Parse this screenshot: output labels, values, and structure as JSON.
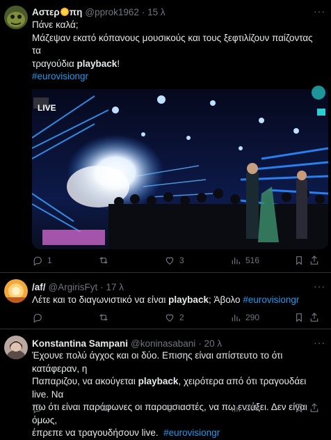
{
  "tweets": [
    {
      "name_prefix": "Αστερ",
      "name_suffix": "πη",
      "handle": "@pprok1962",
      "time": "· 15 λ",
      "line1": "Πάνε καλά;",
      "line2": "Μάζεψαν εκατό κόπανους μουσικούς και τους ξεφτιλίζουν παίζοντας τα",
      "line3_pre": "τραγούδια ",
      "line3_bold": "playback",
      "line3_post": "!",
      "hashtag": "#eurovisiongr",
      "media_live": "LIVE",
      "replies": "1",
      "retweets": "",
      "likes": "3",
      "views": "516"
    },
    {
      "name": "/af/",
      "handle": "@ArgirisFyt",
      "time": "· 17 λ",
      "text_pre": "Λέτε και το διαγωνιστικό να είναι ",
      "text_bold": "playback",
      "text_post": "; Άβολο ",
      "hashtag": "#eurovisiongr",
      "replies": "",
      "retweets": "",
      "likes": "2",
      "views": "290"
    },
    {
      "name": "Konstantina Sampani",
      "handle": "@koninasabani",
      "time": "· 20 λ",
      "line1": "Έχουνε πολύ άγχος και οι δύο. Επισης είναι απίστευτο το ότι κατάφεραν, η",
      "line2_pre": "Παπαριζου, να ακούγεται ",
      "line2_bold": "playback",
      "line2_post": ", χειρότερα από ότι τραγουδάει live. Να",
      "line3": "πω ότι είναι παράφωνες οι παρουσιαστές, να πω εντάξει. Δεν είναι όμως,",
      "line4": "έπρεπε να τραγουδήσουν live.  ",
      "hashtag": "#eurovisiongr",
      "replies": "",
      "retweets": "",
      "likes": "",
      "views": "265"
    }
  ],
  "colors": {
    "accent": "#1d9bf0",
    "muted": "#71767b",
    "border": "#2f3336"
  }
}
